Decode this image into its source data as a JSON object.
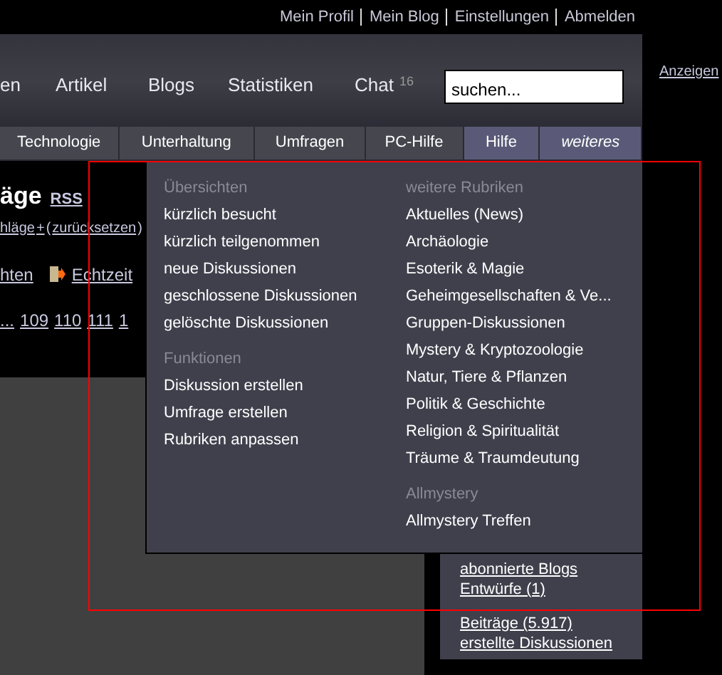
{
  "top_links": [
    "Mein Profil",
    "Mein Blog",
    "Einstellungen",
    "Abmelden"
  ],
  "nav": {
    "items": [
      {
        "label": "en"
      },
      {
        "label": "Artikel"
      },
      {
        "label": "Blogs"
      },
      {
        "label": "Statistiken"
      },
      {
        "label": "Chat",
        "count": "16"
      }
    ],
    "search": {
      "value": "suchen..."
    }
  },
  "ad_link": "Anzeigen",
  "tabs": [
    {
      "label": "Technologie",
      "selected": false,
      "kind": "tab"
    },
    {
      "label": "Unterhaltung",
      "selected": false,
      "kind": "tab"
    },
    {
      "label": "Umfragen",
      "selected": false,
      "kind": "tab"
    },
    {
      "label": "PC-Hilfe",
      "selected": false,
      "kind": "tab"
    },
    {
      "label": "Hilfe",
      "selected": true,
      "kind": "tab"
    },
    {
      "label": "weiteres",
      "selected": true,
      "kind": "more"
    }
  ],
  "content": {
    "title": "äge",
    "rss": "RSS",
    "filter": [
      {
        "label": "hläge",
        "kind": "link"
      },
      {
        "label": "+",
        "kind": "link"
      },
      {
        "label": "(",
        "kind": "text"
      },
      {
        "label": "zurücksetzen",
        "kind": "link"
      },
      {
        "label": ")",
        "kind": "text"
      }
    ],
    "views": [
      {
        "label": "hten",
        "icon": false
      },
      {
        "label": "Echtzeit",
        "icon": true
      }
    ],
    "pages": [
      "...",
      "109",
      "110",
      "111",
      "1"
    ]
  },
  "dropdown": {
    "columns": [
      [
        {
          "kind": "heading",
          "label": "Übersichten"
        },
        {
          "kind": "link",
          "label": "kürzlich besucht"
        },
        {
          "kind": "link",
          "label": "kürzlich teilgenommen"
        },
        {
          "kind": "link",
          "label": "neue Diskussionen"
        },
        {
          "kind": "link",
          "label": "geschlossene Diskussionen"
        },
        {
          "kind": "link",
          "label": "gelöschte Diskussionen"
        },
        {
          "kind": "heading",
          "label": "Funktionen"
        },
        {
          "kind": "link",
          "label": "Diskussion erstellen"
        },
        {
          "kind": "link",
          "label": "Umfrage erstellen"
        },
        {
          "kind": "link",
          "label": "Rubriken anpassen"
        }
      ],
      [
        {
          "kind": "heading",
          "label": "weitere Rubriken"
        },
        {
          "kind": "link",
          "label": "Aktuelles (News)"
        },
        {
          "kind": "link",
          "label": "Archäologie"
        },
        {
          "kind": "link",
          "label": "Esoterik & Magie"
        },
        {
          "kind": "link",
          "label": "Geheimgesellschaften & Ve..."
        },
        {
          "kind": "link",
          "label": "Gruppen-Diskussionen"
        },
        {
          "kind": "link",
          "label": "Mystery & Kryptozoologie"
        },
        {
          "kind": "link",
          "label": "Natur, Tiere & Pflanzen"
        },
        {
          "kind": "link",
          "label": "Politik & Geschichte"
        },
        {
          "kind": "link",
          "label": "Religion & Spiritualität"
        },
        {
          "kind": "link",
          "label": "Träume & Traumdeutung"
        },
        {
          "kind": "heading",
          "label": "Allmystery"
        },
        {
          "kind": "link",
          "label": "Allmystery Treffen"
        }
      ]
    ]
  },
  "sidebar": {
    "groups": [
      [
        "abonnierte Blogs",
        "Entwürfe (1)"
      ],
      [
        "Beiträge (5.917)",
        "erstellte Diskussionen"
      ]
    ]
  }
}
